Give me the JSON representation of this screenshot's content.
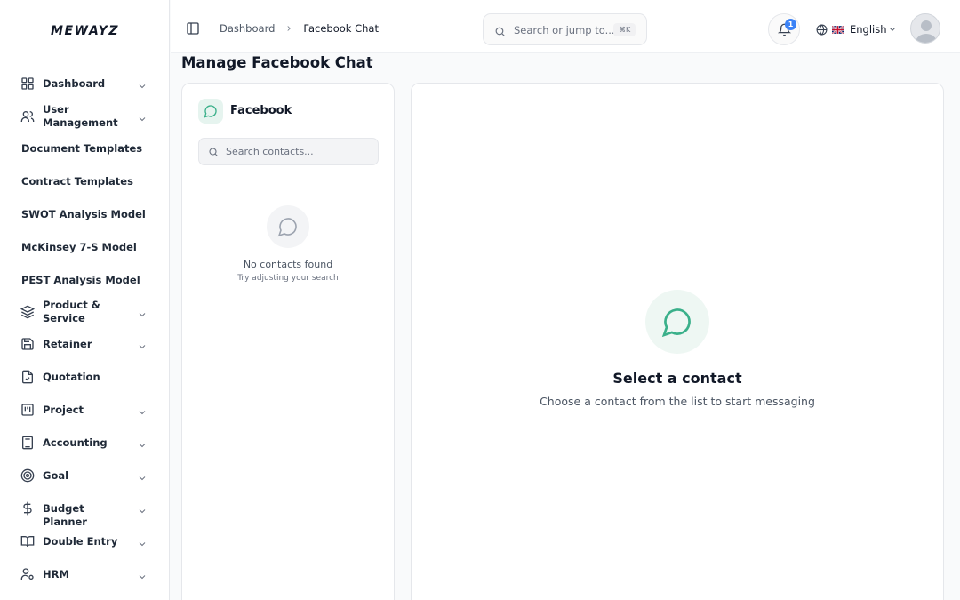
{
  "app": {
    "logo_text": "MEWAYZ"
  },
  "sidebar": {
    "items": [
      {
        "label": "Dashboard",
        "icon": "grid-icon",
        "has_chevron": true
      },
      {
        "label": "User Management",
        "icon": "users-icon",
        "has_chevron": true
      },
      {
        "label": "Document Templates",
        "icon": "",
        "has_chevron": false
      },
      {
        "label": "Contract Templates",
        "icon": "",
        "has_chevron": false
      },
      {
        "label": "SWOT Analysis Model",
        "icon": "",
        "has_chevron": false
      },
      {
        "label": "McKinsey 7-S Model",
        "icon": "",
        "has_chevron": false
      },
      {
        "label": "PEST Analysis Model",
        "icon": "",
        "has_chevron": false
      },
      {
        "label": "Product & Service",
        "icon": "layers-icon",
        "has_chevron": true
      },
      {
        "label": "Retainer",
        "icon": "save-icon",
        "has_chevron": true
      },
      {
        "label": "Quotation",
        "icon": "file-check-icon",
        "has_chevron": false
      },
      {
        "label": "Project",
        "icon": "kanban-icon",
        "has_chevron": true
      },
      {
        "label": "Accounting",
        "icon": "calculator-icon",
        "has_chevron": true
      },
      {
        "label": "Goal",
        "icon": "target-icon",
        "has_chevron": true
      },
      {
        "label": "Budget Planner",
        "icon": "dollar-icon",
        "has_chevron": true
      },
      {
        "label": "Double Entry",
        "icon": "book-icon",
        "has_chevron": true
      },
      {
        "label": "HRM",
        "icon": "user-cog-icon",
        "has_chevron": true
      }
    ]
  },
  "header": {
    "breadcrumb": {
      "parent": "Dashboard",
      "current": "Facebook Chat"
    },
    "search": {
      "placeholder": "Search or jump to...",
      "shortcut": "⌘K"
    },
    "notifications": {
      "count": "1"
    },
    "language": {
      "flag": "🇬🇧",
      "label": "English"
    }
  },
  "main": {
    "page_title": "Manage Facebook Chat",
    "contacts": {
      "title": "Facebook",
      "search_placeholder": "Search contacts...",
      "empty_title": "No contacts found",
      "empty_subtitle": "Try adjusting your search"
    },
    "chat": {
      "empty_title": "Select a contact",
      "empty_subtitle": "Choose a contact from the list to start messaging"
    }
  },
  "colors": {
    "accent": "#3ab08a",
    "badge": "#3b82f6"
  }
}
